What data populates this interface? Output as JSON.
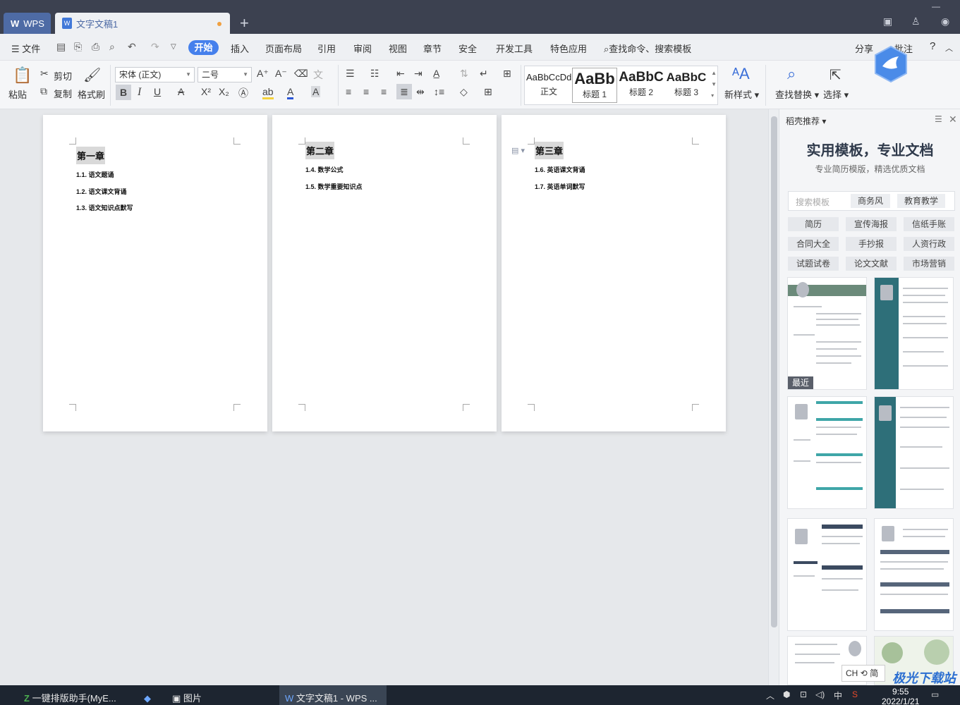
{
  "titlebar": {
    "wps_tab": "WPS",
    "doc_tab": "文字文稿1",
    "new_tab": "+"
  },
  "menubar": {
    "file": "文件",
    "items": [
      "开始",
      "插入",
      "页面布局",
      "引用",
      "审阅",
      "视图",
      "章节",
      "安全",
      "开发工具",
      "特色应用"
    ],
    "search": "查找命令、搜索模板",
    "share": "分享",
    "comment": "批注"
  },
  "ribbon": {
    "paste": "粘贴",
    "cut": "剪切",
    "copy": "复制",
    "format_painter": "格式刷",
    "font_name": "宋体 (正文)",
    "font_size": "二号",
    "styles": [
      {
        "sample": "AaBbCcDd",
        "name": "正文"
      },
      {
        "sample": "AaBb",
        "name": "标题 1"
      },
      {
        "sample": "AaBbC",
        "name": "标题 2"
      },
      {
        "sample": "AaBbC",
        "name": "标题 3"
      }
    ],
    "new_style": "新样式",
    "find_replace": "查找替换",
    "select": "选择"
  },
  "pages": [
    {
      "heading": "第一章",
      "items": [
        "1.1. 语文题诵",
        "1.2. 语文课文背诵",
        "1.3. 语文知识点默写"
      ]
    },
    {
      "heading": "第二章",
      "items": [
        "1.4. 数学公式",
        "1.5. 数学重要知识点"
      ]
    },
    {
      "heading": "第三章",
      "items": [
        "1.6. 英语课文背诵",
        "1.7. 英语单词默写"
      ]
    }
  ],
  "sidepanel": {
    "header": "稻壳推荐",
    "title": "实用模板，专业文档",
    "subtitle": "专业简历模版，精选优质文档",
    "search_placeholder": "搜索模板",
    "chips": [
      "商务风",
      "教育教学"
    ],
    "categories": [
      "简历",
      "宣传海报",
      "信纸手账",
      "合同大全",
      "手抄报",
      "人资行政",
      "试题试卷",
      "论文文献",
      "市场营销"
    ],
    "recent_label": "最近"
  },
  "taskbar": {
    "apps": [
      "一键排版助手(MyE...",
      "图片",
      "文字文稿1 - WPS ..."
    ],
    "ime": "CH",
    "lang": "中",
    "time": "9:55",
    "date": "2022/1/21"
  },
  "watermark": "极光下载站",
  "colors": {
    "accent": "#4580ec",
    "titlebar": "#3c4150",
    "template_teal": "#2e6f79"
  }
}
